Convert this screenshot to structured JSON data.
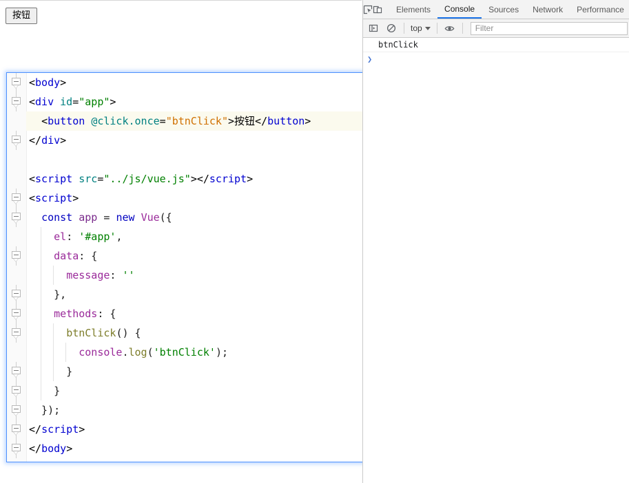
{
  "page": {
    "button_label": "按钮"
  },
  "editor": {
    "lines": [
      {
        "fold": true,
        "indents": 0,
        "highlight": false,
        "tokens": [
          {
            "t": "punct",
            "s": "<"
          },
          {
            "t": "tag",
            "s": "body"
          },
          {
            "t": "punct",
            "s": ">"
          }
        ]
      },
      {
        "fold": true,
        "indents": 0,
        "highlight": false,
        "tokens": [
          {
            "t": "punct",
            "s": "<"
          },
          {
            "t": "tag",
            "s": "div "
          },
          {
            "t": "attr",
            "s": "id"
          },
          {
            "t": "punct",
            "s": "="
          },
          {
            "t": "attrval2",
            "s": "\"app\""
          },
          {
            "t": "punct",
            "s": ">"
          }
        ]
      },
      {
        "fold": false,
        "indents": 0,
        "highlight": true,
        "tokens": [
          {
            "t": "plain",
            "s": "  "
          },
          {
            "t": "punct",
            "s": "<"
          },
          {
            "t": "tag",
            "s": "button "
          },
          {
            "t": "attr",
            "s": "@click.once"
          },
          {
            "t": "punct",
            "s": "="
          },
          {
            "t": "attrval",
            "s": "\"btnClick\""
          },
          {
            "t": "punct",
            "s": ">"
          },
          {
            "t": "text",
            "s": "按钮"
          },
          {
            "t": "punct",
            "s": "</"
          },
          {
            "t": "tag",
            "s": "button"
          },
          {
            "t": "punct",
            "s": ">"
          }
        ]
      },
      {
        "fold": true,
        "indents": 0,
        "highlight": false,
        "tokens": [
          {
            "t": "punct",
            "s": "</"
          },
          {
            "t": "tag",
            "s": "div"
          },
          {
            "t": "punct",
            "s": ">"
          }
        ]
      },
      {
        "fold": false,
        "indents": 0,
        "highlight": false,
        "tokens": []
      },
      {
        "fold": false,
        "indents": 0,
        "highlight": false,
        "tokens": [
          {
            "t": "punct",
            "s": "<"
          },
          {
            "t": "tag",
            "s": "script "
          },
          {
            "t": "attr",
            "s": "src"
          },
          {
            "t": "punct",
            "s": "="
          },
          {
            "t": "attrval2",
            "s": "\"../js/vue.js\""
          },
          {
            "t": "punct",
            "s": "></"
          },
          {
            "t": "tag",
            "s": "script"
          },
          {
            "t": "punct",
            "s": ">"
          }
        ]
      },
      {
        "fold": true,
        "indents": 0,
        "highlight": false,
        "tokens": [
          {
            "t": "punct",
            "s": "<"
          },
          {
            "t": "tag",
            "s": "script"
          },
          {
            "t": "punct",
            "s": ">"
          }
        ]
      },
      {
        "fold": true,
        "indents": 0,
        "highlight": false,
        "tokens": [
          {
            "t": "plain",
            "s": "  "
          },
          {
            "t": "kw",
            "s": "const"
          },
          {
            "t": "plain",
            "s": " "
          },
          {
            "t": "ident",
            "s": "app"
          },
          {
            "t": "plain",
            "s": " = "
          },
          {
            "t": "kw",
            "s": "new"
          },
          {
            "t": "plain",
            "s": " "
          },
          {
            "t": "obj",
            "s": "Vue"
          },
          {
            "t": "plain",
            "s": "({"
          }
        ]
      },
      {
        "fold": false,
        "indents": 1,
        "highlight": false,
        "tokens": [
          {
            "t": "plain",
            "s": "    "
          },
          {
            "t": "prop",
            "s": "el"
          },
          {
            "t": "plain",
            "s": ": "
          },
          {
            "t": "str",
            "s": "'#app'"
          },
          {
            "t": "plain",
            "s": ","
          }
        ]
      },
      {
        "fold": true,
        "indents": 1,
        "highlight": false,
        "tokens": [
          {
            "t": "plain",
            "s": "    "
          },
          {
            "t": "prop",
            "s": "data"
          },
          {
            "t": "plain",
            "s": ": {"
          }
        ]
      },
      {
        "fold": false,
        "indents": 2,
        "highlight": false,
        "tokens": [
          {
            "t": "plain",
            "s": "      "
          },
          {
            "t": "prop",
            "s": "message"
          },
          {
            "t": "plain",
            "s": ": "
          },
          {
            "t": "str",
            "s": "''"
          }
        ]
      },
      {
        "fold": true,
        "indents": 1,
        "highlight": false,
        "tokens": [
          {
            "t": "plain",
            "s": "    },"
          }
        ]
      },
      {
        "fold": true,
        "indents": 1,
        "highlight": false,
        "tokens": [
          {
            "t": "plain",
            "s": "    "
          },
          {
            "t": "prop",
            "s": "methods"
          },
          {
            "t": "plain",
            "s": ": {"
          }
        ]
      },
      {
        "fold": true,
        "indents": 2,
        "highlight": false,
        "tokens": [
          {
            "t": "plain",
            "s": "      "
          },
          {
            "t": "fn",
            "s": "btnClick"
          },
          {
            "t": "plain",
            "s": "() {"
          }
        ]
      },
      {
        "fold": false,
        "indents": 3,
        "highlight": false,
        "tokens": [
          {
            "t": "plain",
            "s": "        "
          },
          {
            "t": "obj",
            "s": "console"
          },
          {
            "t": "plain",
            "s": "."
          },
          {
            "t": "fn",
            "s": "log"
          },
          {
            "t": "plain",
            "s": "("
          },
          {
            "t": "str",
            "s": "'btnClick'"
          },
          {
            "t": "plain",
            "s": ");"
          }
        ]
      },
      {
        "fold": true,
        "indents": 2,
        "highlight": false,
        "tokens": [
          {
            "t": "plain",
            "s": "      }"
          }
        ]
      },
      {
        "fold": true,
        "indents": 1,
        "highlight": false,
        "tokens": [
          {
            "t": "plain",
            "s": "    }"
          }
        ]
      },
      {
        "fold": true,
        "indents": 0,
        "highlight": false,
        "tokens": [
          {
            "t": "plain",
            "s": "  });"
          }
        ]
      },
      {
        "fold": true,
        "indents": 0,
        "highlight": false,
        "tokens": [
          {
            "t": "punct",
            "s": "</"
          },
          {
            "t": "tag",
            "s": "script"
          },
          {
            "t": "punct",
            "s": ">"
          }
        ]
      },
      {
        "fold": true,
        "indents": 0,
        "highlight": false,
        "tokens": [
          {
            "t": "punct",
            "s": "</"
          },
          {
            "t": "tag",
            "s": "body"
          },
          {
            "t": "punct",
            "s": ">"
          }
        ]
      }
    ]
  },
  "devtools": {
    "icons": {
      "inspect": "inspect-element-icon",
      "device": "device-toolbar-icon",
      "sidebar": "console-sidebar-icon",
      "clear": "clear-console-icon",
      "eye": "live-expression-icon"
    },
    "tabs": [
      {
        "label": "Elements",
        "active": false
      },
      {
        "label": "Console",
        "active": true
      },
      {
        "label": "Sources",
        "active": false
      },
      {
        "label": "Network",
        "active": false
      },
      {
        "label": "Performance",
        "active": false
      }
    ],
    "context_label": "top",
    "filter_placeholder": "Filter",
    "filter_value": "",
    "console_messages": [
      {
        "text": "btnClick"
      }
    ],
    "prompt_value": "",
    "prompt_chevron": "❯"
  },
  "colors": {
    "accent": "#1a73e8",
    "editor_border": "#4d90fe",
    "highlight_line": "#fbfaee",
    "toolbar_bg": "#f3f3f3"
  }
}
